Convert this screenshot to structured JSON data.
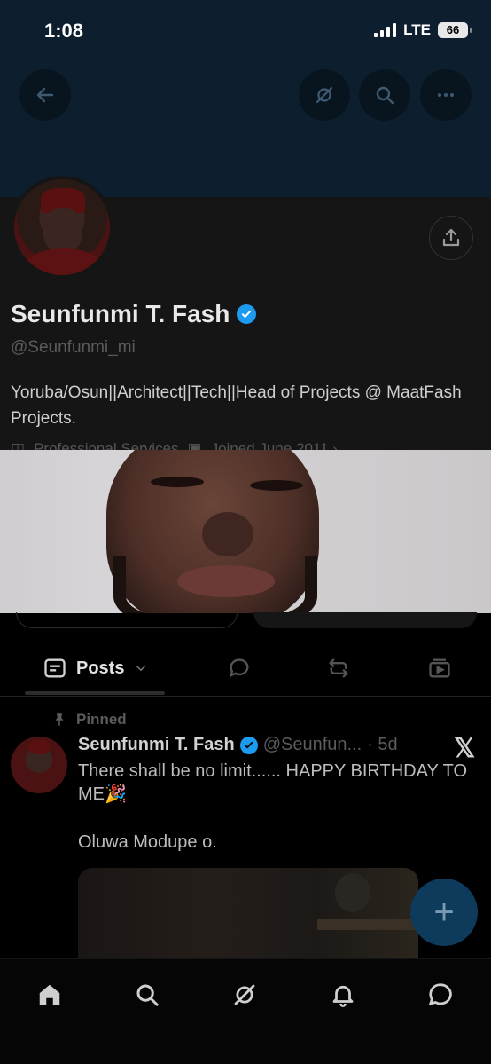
{
  "status_bar": {
    "time": "1:08",
    "network": "LTE",
    "battery": "66"
  },
  "header": {
    "icons": [
      "back-arrow-icon",
      "grok-icon",
      "search-icon",
      "more-icon"
    ]
  },
  "profile": {
    "display_name": "Seunfunmi T. Fash",
    "handle": "@Seunfunmi_mi",
    "bio": "Yoruba/Osun||Architect||Tech||Head of Projects @ MaatFash Projects.",
    "meta_category": "Professional Services",
    "meta_joined": "Joined June 2011 ›",
    "verified": true
  },
  "tabs": {
    "posts_label": "Posts"
  },
  "post": {
    "pinned_label": "Pinned",
    "author_name": "Seunfunmi T. Fash",
    "author_handle": "@Seunfun...",
    "time": "· 5d",
    "text": "There shall be no limit...... HAPPY BIRTHDAY TO ME🎉",
    "text2": "Oluwa Modupe o.",
    "source_logo": "𝕏"
  },
  "fab": {
    "label": "+"
  },
  "bottom_nav": {
    "items": [
      "home-icon",
      "search-icon",
      "grok-icon",
      "notifications-icon",
      "messages-icon"
    ]
  },
  "colors": {
    "accent": "#1d9bf0",
    "background": "#000000",
    "banner": "#0d1f2f"
  }
}
